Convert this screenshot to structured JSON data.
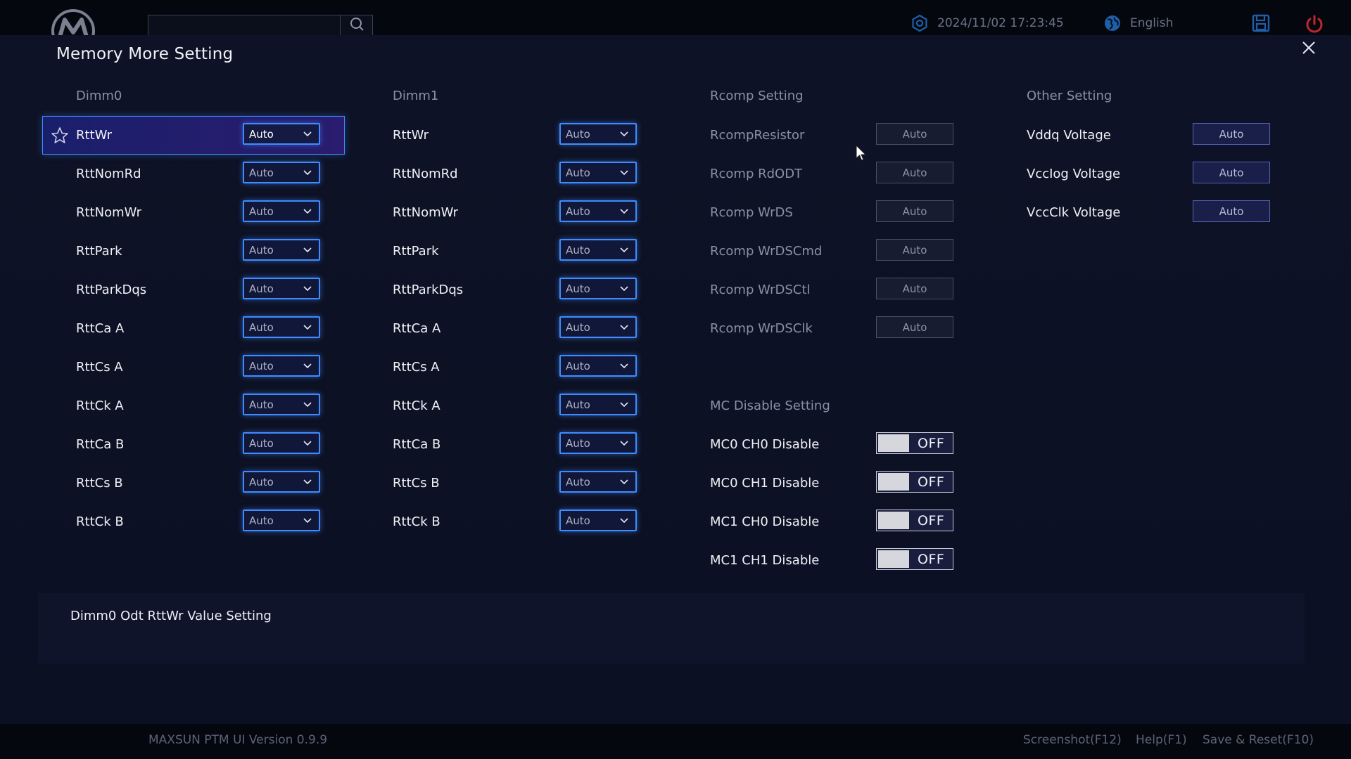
{
  "topbar": {
    "search": {
      "placeholder": "",
      "value": ""
    },
    "datetime": "2024/11/02 17:23:45",
    "language": "English"
  },
  "panel": {
    "title": "Memory More Setting",
    "dimm0": {
      "header": "Dimm0",
      "items": [
        {
          "label": "RttWr",
          "value": "Auto"
        },
        {
          "label": "RttNomRd",
          "value": "Auto"
        },
        {
          "label": "RttNomWr",
          "value": "Auto"
        },
        {
          "label": "RttPark",
          "value": "Auto"
        },
        {
          "label": "RttParkDqs",
          "value": "Auto"
        },
        {
          "label": "RttCa A",
          "value": "Auto"
        },
        {
          "label": "RttCs A",
          "value": "Auto"
        },
        {
          "label": "RttCk A",
          "value": "Auto"
        },
        {
          "label": "RttCa B",
          "value": "Auto"
        },
        {
          "label": "RttCs B",
          "value": "Auto"
        },
        {
          "label": "RttCk B",
          "value": "Auto"
        }
      ]
    },
    "dimm1": {
      "header": "Dimm1",
      "items": [
        {
          "label": "RttWr",
          "value": "Auto"
        },
        {
          "label": "RttNomRd",
          "value": "Auto"
        },
        {
          "label": "RttNomWr",
          "value": "Auto"
        },
        {
          "label": "RttPark",
          "value": "Auto"
        },
        {
          "label": "RttParkDqs",
          "value": "Auto"
        },
        {
          "label": "RttCa A",
          "value": "Auto"
        },
        {
          "label": "RttCs A",
          "value": "Auto"
        },
        {
          "label": "RttCk A",
          "value": "Auto"
        },
        {
          "label": "RttCa B",
          "value": "Auto"
        },
        {
          "label": "RttCs B",
          "value": "Auto"
        },
        {
          "label": "RttCk B",
          "value": "Auto"
        }
      ]
    },
    "rcomp": {
      "header": "Rcomp Setting",
      "items": [
        {
          "label": "RcompResistor",
          "value": "Auto"
        },
        {
          "label": "Rcomp RdODT",
          "value": "Auto"
        },
        {
          "label": "Rcomp WrDS",
          "value": "Auto"
        },
        {
          "label": "Rcomp WrDSCmd",
          "value": "Auto"
        },
        {
          "label": "Rcomp WrDSCtl",
          "value": "Auto"
        },
        {
          "label": "Rcomp WrDSClk",
          "value": "Auto"
        }
      ]
    },
    "mc_disable": {
      "header": "MC Disable Setting",
      "items": [
        {
          "label": "MC0 CH0 Disable",
          "state": "OFF"
        },
        {
          "label": "MC0 CH1 Disable",
          "state": "OFF"
        },
        {
          "label": "MC1 CH0 Disable",
          "state": "OFF"
        },
        {
          "label": "MC1 CH1 Disable",
          "state": "OFF"
        }
      ]
    },
    "other": {
      "header": "Other Setting",
      "items": [
        {
          "label": "Vddq Voltage",
          "value": "Auto"
        },
        {
          "label": "VccIog Voltage",
          "value": "Auto"
        },
        {
          "label": "VccClk Voltage",
          "value": "Auto"
        }
      ]
    },
    "help_text": "Dimm0 Odt RttWr Value Setting"
  },
  "footer": {
    "version": "MAXSUN PTM UI Version 0.9.9",
    "screenshot": "Screenshot(F12)",
    "help": "Help(F1)",
    "save_reset": "Save & Reset(F10)"
  },
  "colors": {
    "accent_blue": "#3e8cff",
    "selected_bg": "#1a1f6b",
    "power_red": "#c0262b",
    "icon_blue": "#1e5fa8"
  },
  "icons": [
    "brand-logo-icon",
    "search-icon",
    "settings-icon",
    "globe-icon",
    "save-icon",
    "power-icon",
    "close-icon",
    "star-icon",
    "chevron-down-icon",
    "mouse-cursor-icon"
  ]
}
